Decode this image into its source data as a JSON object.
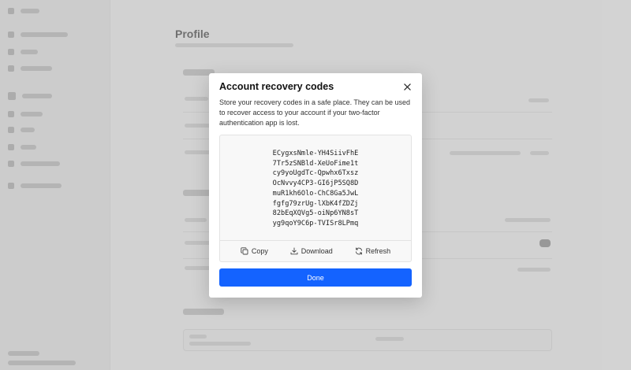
{
  "modal": {
    "title": "Account recovery codes",
    "description": "Store your recovery codes in a safe place. They can be used to recover access to your account if your two-factor authentication app is lost.",
    "codes": [
      "ECygxsNmle-YH4SiivFhE",
      "7Tr5zSNBld-XeUoFime1t",
      "cy9yoUgdTc-Qpwhx6Txsz",
      "OcNvvy4CP3-GI6jP5SQ8D",
      "muR1kh6Olo-ChC8Ga5JwL",
      "fgfg79zrUg-lXbK4fZDZj",
      "82bEqXQVg5-oiNp6YN8sT",
      "yg9qoY9C6p-TVISr8LPmq"
    ],
    "actions": {
      "copy": "Copy",
      "download": "Download",
      "refresh": "Refresh"
    },
    "done_label": "Done",
    "primary_color": "#1463ff"
  },
  "background": {
    "page_title": "Profile"
  }
}
